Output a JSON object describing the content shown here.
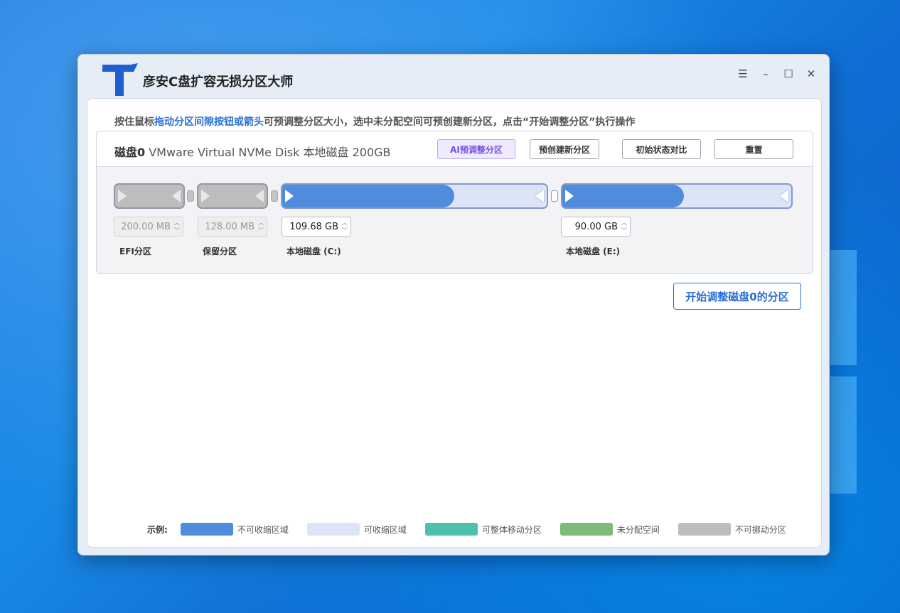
{
  "app": {
    "title": "彦安C盘扩容无损分区大师"
  },
  "window_controls": {
    "menu": "☰",
    "minimize": "–",
    "maximize": "☐",
    "close": "✕"
  },
  "hint": {
    "part1": "按住鼠标",
    "highlight": "拖动分区间隙按钮或箭头",
    "part2": "可预调整分区大小，选中未分配空间可预创建新分区，点击“开始调整分区”执行操作"
  },
  "disk": {
    "label": "磁盘0",
    "description": " VMware Virtual NVMe Disk 本地磁盘 200GB",
    "buttons": {
      "ai_adjust": "AI预调整分区",
      "pre_create": "预创建新分区",
      "compare": "初始状态对比",
      "reset": "重置"
    },
    "partitions": [
      {
        "name": "EFI分区",
        "size": "200.00 MB",
        "locked": true
      },
      {
        "name": "保留分区",
        "size": "128.00 MB",
        "locked": true
      },
      {
        "name": "本地磁盘 (C:)",
        "size": "109.68 GB",
        "locked": false,
        "used_fraction": 0.65
      },
      {
        "name": "本地磁盘 (E:)",
        "size": "90.00 GB",
        "locked": false,
        "used_fraction": 0.53
      }
    ]
  },
  "start_button": "开始调整磁盘0的分区",
  "legend": {
    "title": "示例:",
    "items": [
      {
        "label": "不可收缩区域",
        "color": "#4f8cdb"
      },
      {
        "label": "可收缩区域",
        "color": "#dce4f7"
      },
      {
        "label": "可整体移动分区",
        "color": "#4cc0ad"
      },
      {
        "label": "未分配空间",
        "color": "#7cbb78"
      },
      {
        "label": "不可挪动分区",
        "color": "#bdbdbd"
      }
    ]
  },
  "colors": {
    "accent": "#2b6fd6",
    "used": "#4f8cdb",
    "free": "#dce4f7",
    "locked": "#bdbdbd"
  }
}
